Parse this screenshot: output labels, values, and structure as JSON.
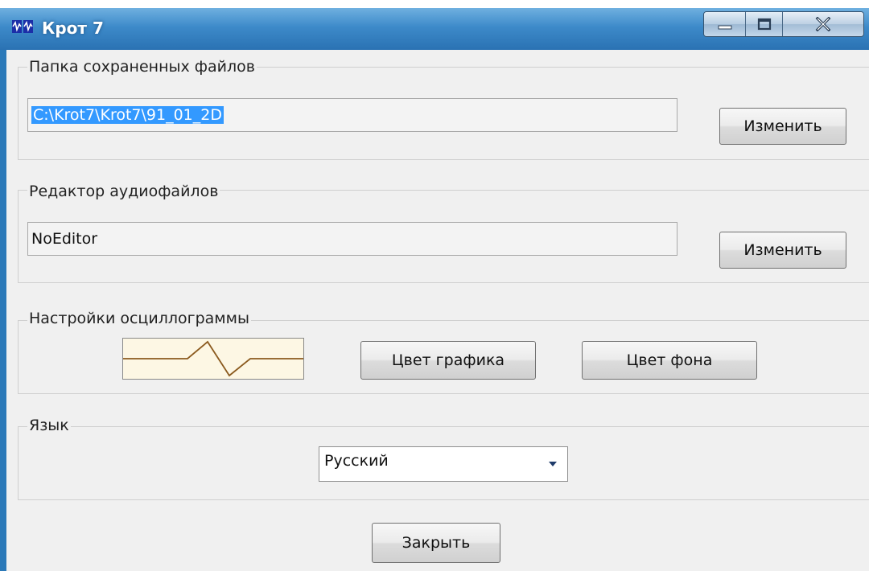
{
  "window": {
    "title": "Крот 7",
    "controls": {
      "minimize": "minimize",
      "maximize": "maximize",
      "close": "close"
    }
  },
  "save_folder": {
    "label": "Папка сохраненных файлов",
    "path_value": "C:\\Krot7\\Krot7\\91_01_2D",
    "change_button": "Изменить"
  },
  "audio_editor": {
    "label": "Редактор аудиофайлов",
    "value": "NoEditor",
    "change_button": "Изменить"
  },
  "waveform_settings": {
    "label": "Настройки осциллограммы",
    "graph_color_button": "Цвет графика",
    "background_color_button": "Цвет фона",
    "colors": {
      "line": "#8b5a1e",
      "background": "#fdf7e4"
    }
  },
  "language": {
    "label": "Язык",
    "selected": "Русский"
  },
  "footer": {
    "close_button": "Закрыть"
  },
  "theme": {
    "titlebar": "#3d8ac9",
    "selection": "#3399ff"
  }
}
